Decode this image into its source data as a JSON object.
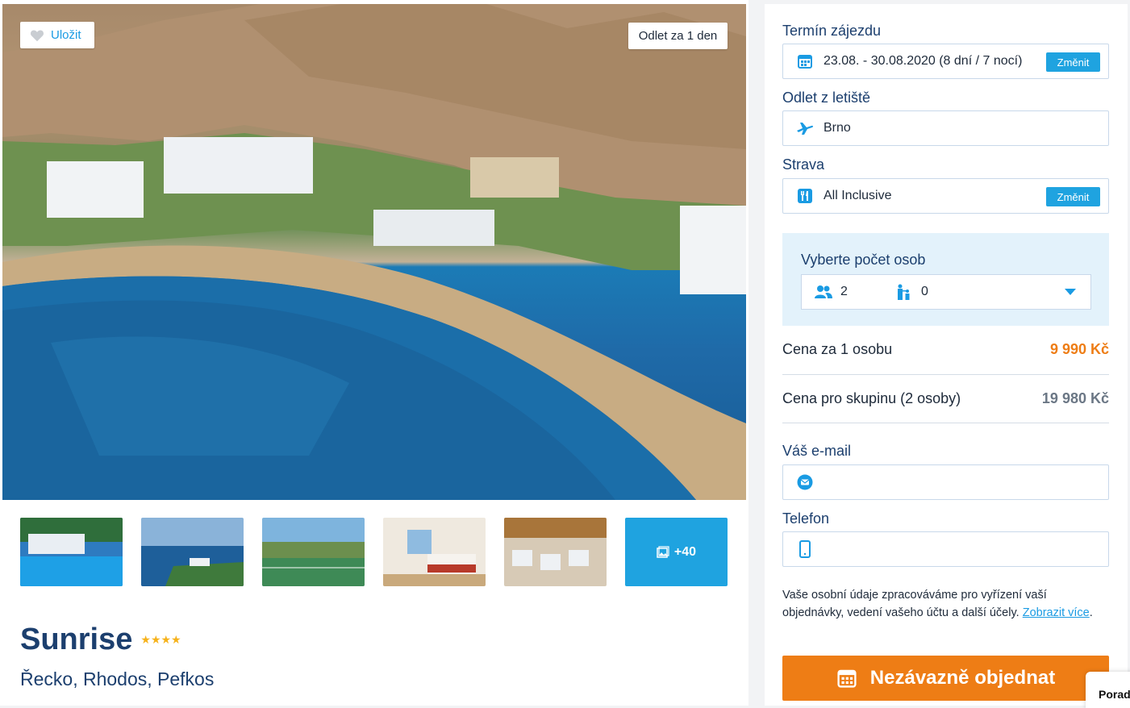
{
  "gallery": {
    "save_label": "Uložit",
    "departure_badge": "Odlet za 1 den",
    "more_photos": "+40"
  },
  "hotel": {
    "name": "Sunrise",
    "stars": 4,
    "stars_text": "★★★★",
    "location": "Řecko, Rhodos, Pefkos"
  },
  "booking": {
    "term_label": "Termín zájezdu",
    "term_value": "23.08. - 30.08.2020 (8 dní / 7 nocí)",
    "change_label": "Změnit",
    "airport_label": "Odlet z letiště",
    "airport_value": "Brno",
    "board_label": "Strava",
    "board_value": "All Inclusive",
    "persons_label": "Vyberte počet osob",
    "adults": "2",
    "children": "0",
    "price_per_person_label": "Cena za 1 osobu",
    "price_per_person": "9 990 Kč",
    "price_group_label": "Cena pro skupinu (2 osoby)",
    "price_group": "19 980 Kč",
    "email_label": "Váš e-mail",
    "email_value": "",
    "phone_label": "Telefon",
    "phone_value": "",
    "privacy_text": "Vaše osobní údaje zpracováváme pro vyřízení vaší objednávky, vedení vašeho účtu a další účely.",
    "privacy_link": "Zobrazit více",
    "order_label": "Nezávazně objednat"
  },
  "chat": {
    "label": "Porad"
  },
  "colors": {
    "accent": "#1fa3e0",
    "order": "#ee7d15",
    "heading": "#1c3f6e"
  }
}
